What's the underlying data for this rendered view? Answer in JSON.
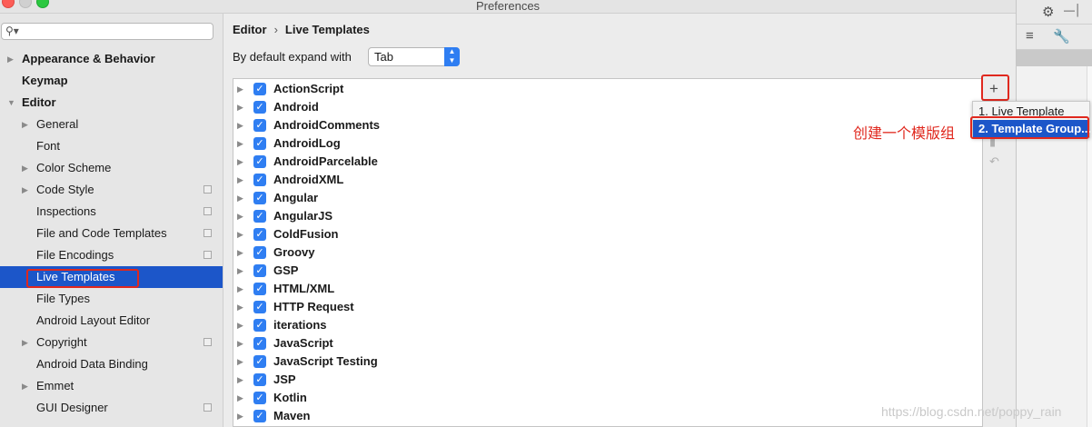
{
  "window": {
    "title": "Preferences"
  },
  "sidebar": {
    "search_icon": "magnifier-icon",
    "items": [
      {
        "label": "Appearance & Behavior",
        "level": 0,
        "arrow": true,
        "bold": true
      },
      {
        "label": "Keymap",
        "level": 0,
        "arrow": false,
        "bold": true
      },
      {
        "label": "Editor",
        "level": 0,
        "arrow": "down",
        "bold": true
      },
      {
        "label": "General",
        "level": 1,
        "arrow": true
      },
      {
        "label": "Font",
        "level": 1,
        "arrow": false
      },
      {
        "label": "Color Scheme",
        "level": 1,
        "arrow": true
      },
      {
        "label": "Code Style",
        "level": 1,
        "arrow": true,
        "cfg": true
      },
      {
        "label": "Inspections",
        "level": 1,
        "arrow": false,
        "cfg": true
      },
      {
        "label": "File and Code Templates",
        "level": 1,
        "arrow": false,
        "cfg": true
      },
      {
        "label": "File Encodings",
        "level": 1,
        "arrow": false,
        "cfg": true
      },
      {
        "label": "Live Templates",
        "level": 1,
        "arrow": false,
        "selected": true
      },
      {
        "label": "File Types",
        "level": 1,
        "arrow": false
      },
      {
        "label": "Android Layout Editor",
        "level": 1,
        "arrow": false
      },
      {
        "label": "Copyright",
        "level": 1,
        "arrow": true,
        "cfg": true
      },
      {
        "label": "Android Data Binding",
        "level": 1,
        "arrow": false
      },
      {
        "label": "Emmet",
        "level": 1,
        "arrow": true
      },
      {
        "label": "GUI Designer",
        "level": 1,
        "arrow": false,
        "cfg": true
      }
    ]
  },
  "main": {
    "breadcrumb": {
      "parent": "Editor",
      "current": "Live Templates"
    },
    "expand_label": "By default expand with",
    "expand_value": "Tab",
    "template_groups": [
      "ActionScript",
      "Android",
      "AndroidComments",
      "AndroidLog",
      "AndroidParcelable",
      "AndroidXML",
      "Angular",
      "AngularJS",
      "ColdFusion",
      "Groovy",
      "GSP",
      "HTML/XML",
      "HTTP Request",
      "iterations",
      "JavaScript",
      "JavaScript Testing",
      "JSP",
      "Kotlin",
      "Maven"
    ]
  },
  "popup": {
    "items": [
      "1. Live Template",
      "2. Template Group..."
    ],
    "active_index": 1
  },
  "annotation": "创建一个模版组",
  "watermark": "https://blog.csdn.net/poppy_rain",
  "colors": {
    "accent": "#1c56c9",
    "checkbox": "#2f7ef2",
    "highlight": "#e0281e"
  }
}
